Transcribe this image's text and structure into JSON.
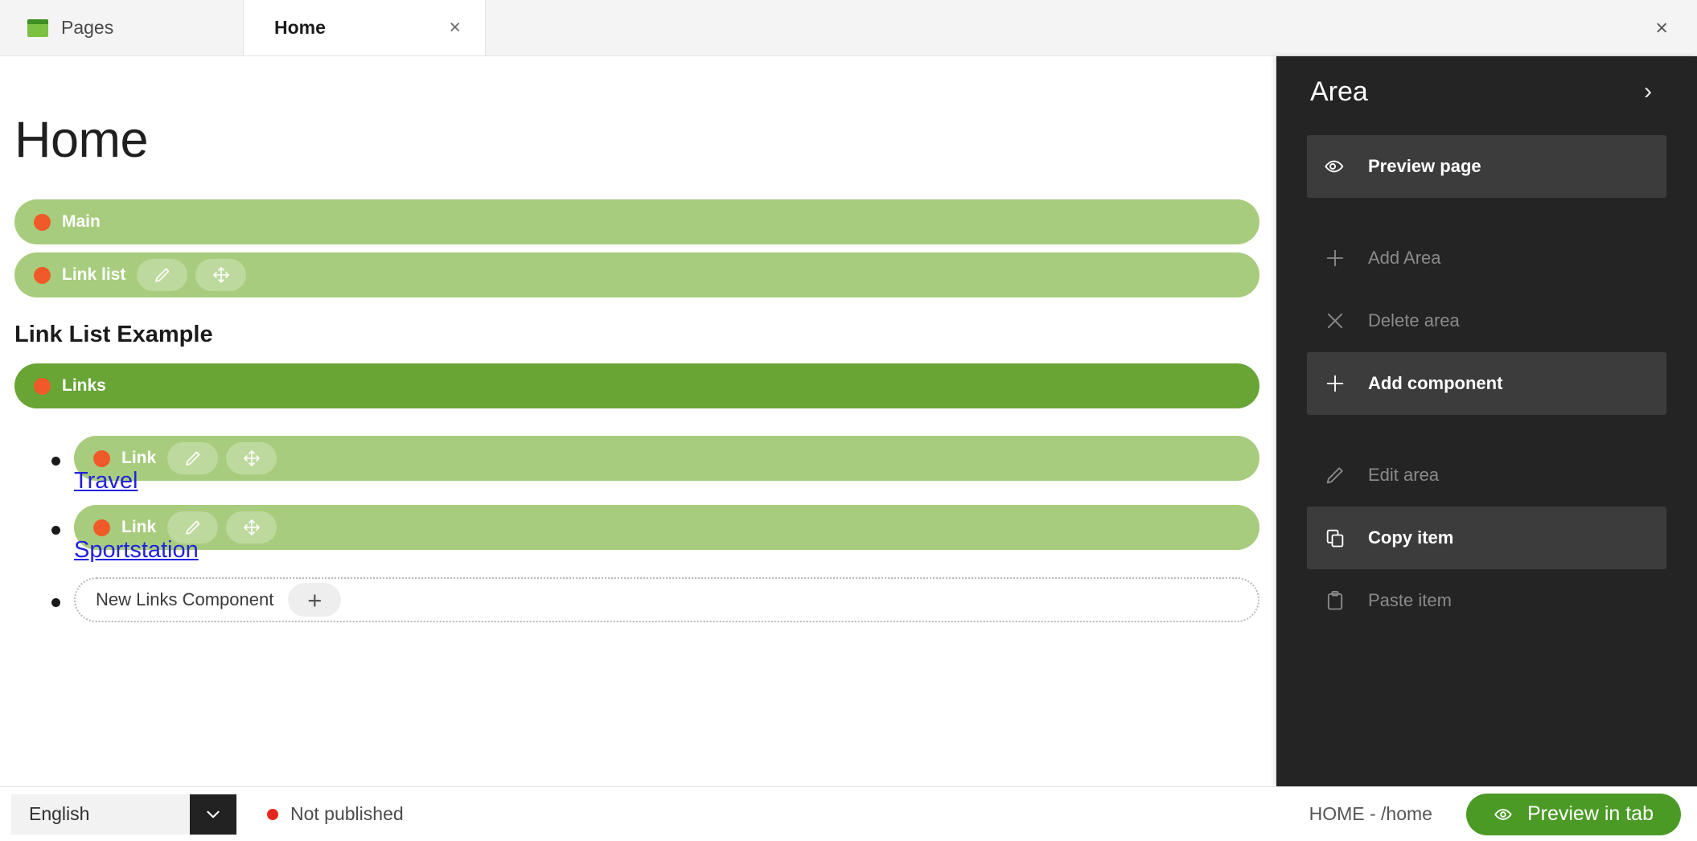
{
  "tabs": [
    {
      "label": "Pages",
      "icon": "pages-icon",
      "active": false
    },
    {
      "label": "Home",
      "icon": "",
      "active": true,
      "close": "×"
    }
  ],
  "window": {
    "close": "×"
  },
  "canvas": {
    "page_title": "Home",
    "section_title": "Link List Example",
    "bars": [
      {
        "label": "Main",
        "tone": "light",
        "has_tools": false
      },
      {
        "label": "Link list",
        "tone": "light",
        "has_tools": true
      },
      {
        "label": "Links",
        "tone": "dark",
        "has_tools": false
      }
    ],
    "links": [
      {
        "chip_label": "Link",
        "text": "Travel"
      },
      {
        "chip_label": "Link",
        "text": "Sportstation"
      }
    ],
    "new_component": {
      "label": "New Links Component",
      "add": "+"
    },
    "tool_icons": {
      "edit": "pencil-icon",
      "move": "move-icon"
    }
  },
  "panel": {
    "title": "Area",
    "chevron": "›",
    "groups": [
      [
        {
          "label": "Preview page",
          "icon": "eye-icon",
          "enabled": true
        }
      ],
      [
        {
          "label": "Add Area",
          "icon": "plus-icon",
          "enabled": false
        },
        {
          "label": "Delete area",
          "icon": "close-icon",
          "enabled": false
        },
        {
          "label": "Add component",
          "icon": "plus-icon",
          "enabled": true
        }
      ],
      [
        {
          "label": "Edit area",
          "icon": "pencil-icon",
          "enabled": false
        },
        {
          "label": "Copy item",
          "icon": "copy-icon",
          "enabled": true
        },
        {
          "label": "Paste item",
          "icon": "clipboard-icon",
          "enabled": false
        }
      ]
    ]
  },
  "statusbar": {
    "language": "English",
    "language_arrow": "chevron-down-icon",
    "publish_status": "Not published",
    "path": "HOME - /home",
    "preview_button": "Preview in tab",
    "preview_icon": "eye-icon"
  },
  "colors": {
    "chip_light": "#a8cc7d",
    "chip_dark": "#68a535",
    "dot": "#f05a28",
    "panel_bg": "#242424",
    "panel_item_active": "#3c3c3c",
    "link": "#2222dd",
    "preview_green": "#4b9a26",
    "unpublished": "#e8271c"
  }
}
